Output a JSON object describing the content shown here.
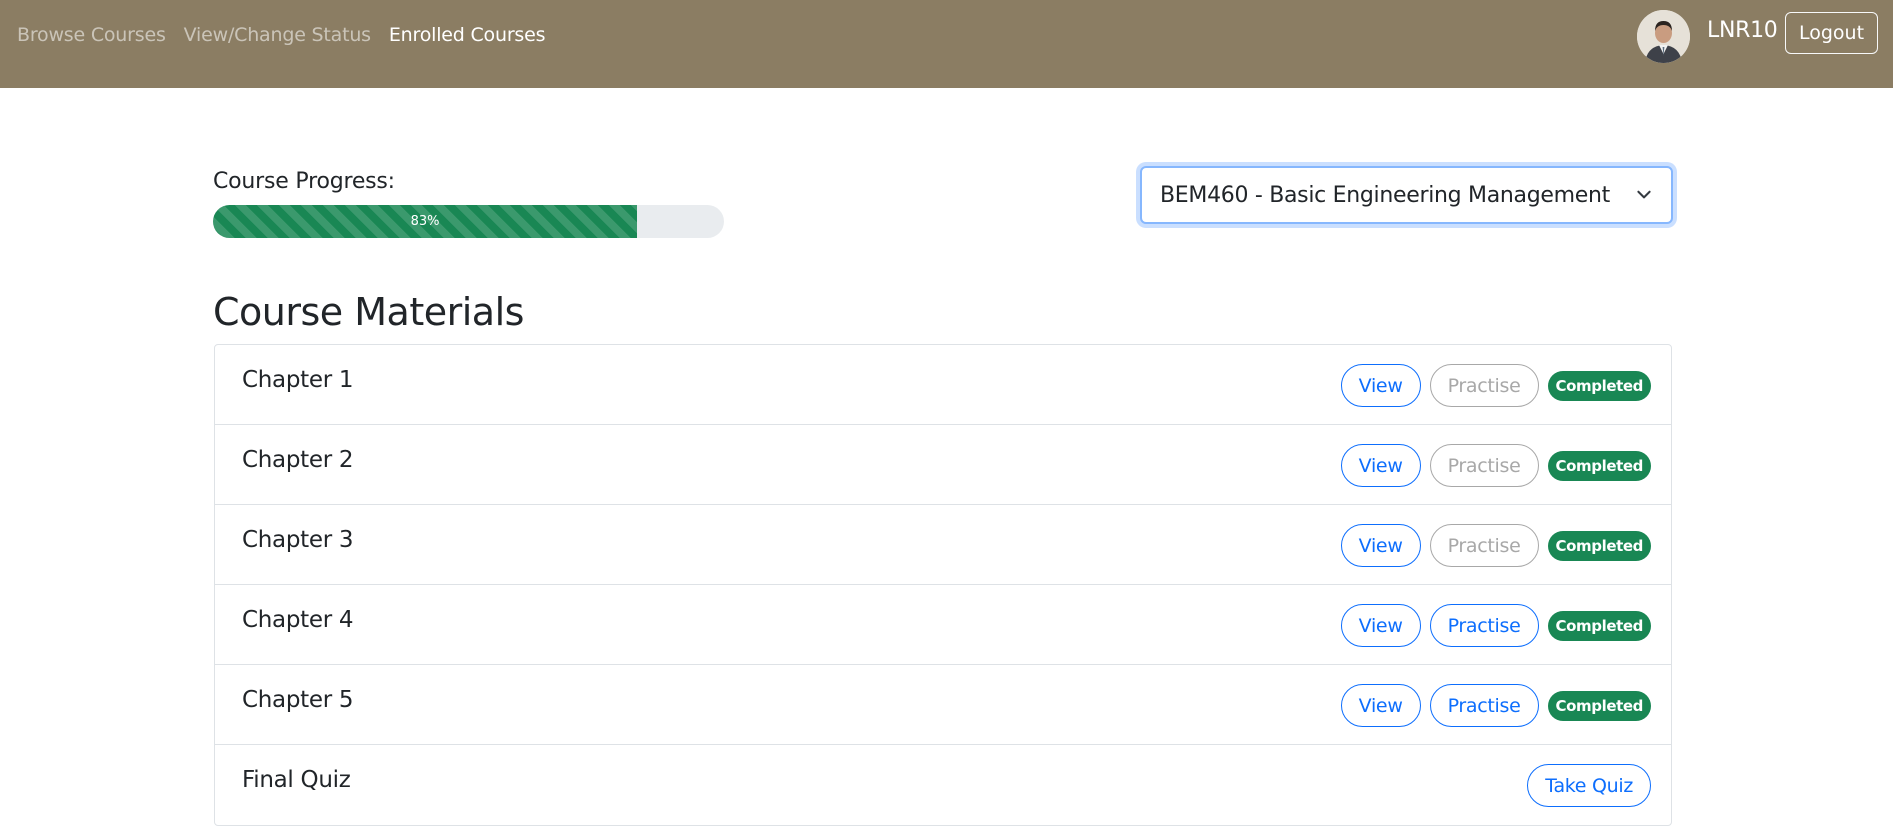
{
  "nav": {
    "links": [
      "Browse Courses",
      "View/Change Status",
      "Enrolled Courses"
    ],
    "active_index": 2
  },
  "user": {
    "name": "LNR10",
    "logout_label": "Logout",
    "avatar_icon": "user-avatar-photo"
  },
  "progress": {
    "label": "Course Progress:",
    "percent": 83,
    "percent_text": "83%"
  },
  "course_select": {
    "selected": "BEM460 - Basic Engineering Management",
    "icon": "chevron-down-icon"
  },
  "materials": {
    "title": "Course Materials",
    "items": [
      {
        "title": "Chapter 1",
        "view_label": "View",
        "practise_label": "Practise",
        "practise_enabled": false,
        "status": "Completed"
      },
      {
        "title": "Chapter 2",
        "view_label": "View",
        "practise_label": "Practise",
        "practise_enabled": false,
        "status": "Completed"
      },
      {
        "title": "Chapter 3",
        "view_label": "View",
        "practise_label": "Practise",
        "practise_enabled": false,
        "status": "Completed"
      },
      {
        "title": "Chapter 4",
        "view_label": "View",
        "practise_label": "Practise",
        "practise_enabled": true,
        "status": "Completed"
      },
      {
        "title": "Chapter 5",
        "view_label": "View",
        "practise_label": "Practise",
        "practise_enabled": true,
        "status": "Completed"
      }
    ],
    "final_quiz": {
      "title": "Final Quiz",
      "button_label": "Take Quiz"
    }
  },
  "colors": {
    "navbar": "#8b7d63",
    "primary": "#0d6efd",
    "success": "#198754",
    "disabled": "#a8a8a8"
  }
}
